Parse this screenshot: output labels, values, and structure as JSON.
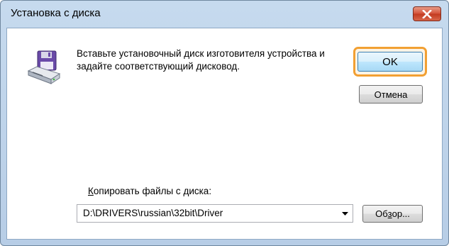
{
  "window": {
    "title": "Установка с диска"
  },
  "dialog": {
    "message": "Вставьте установочный диск изготовителя устройства и задайте соответствующий дисковод.",
    "ok_label": "OK",
    "cancel_label": "Отмена",
    "copy_label_prefix": "К",
    "copy_label_rest": "опировать файлы с диска:",
    "path_value": "D:\\DRIVERS\\russian\\32bit\\Driver",
    "browse_label_prefix": "Об",
    "browse_label_underlined": "з",
    "browse_label_suffix": "ор..."
  },
  "icons": {
    "close": "close-x-icon",
    "install_disk": "install-disk-icon",
    "dropdown": "chevron-down-icon"
  },
  "colors": {
    "title_gradient_top": "#c6daee",
    "close_button": "#c23a1f",
    "focus_ring": "#f2a033",
    "ok_border": "#3c7fb1"
  }
}
